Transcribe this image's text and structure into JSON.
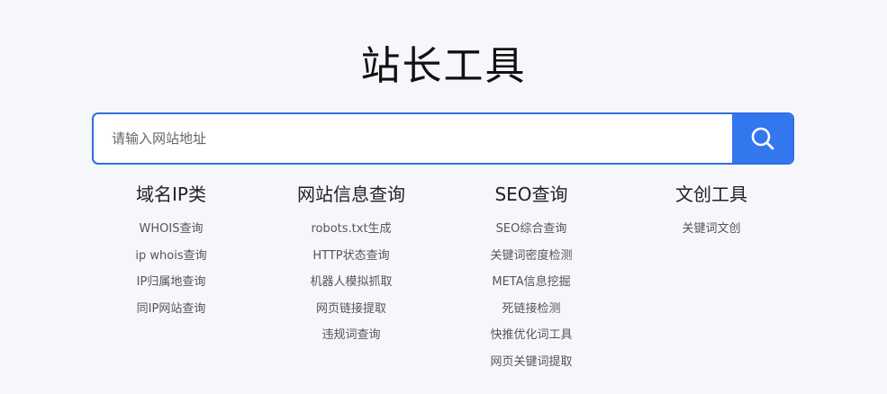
{
  "header": {
    "title": "站长工具"
  },
  "search": {
    "placeholder": "请输入网站地址",
    "button_icon": "search-icon",
    "accent_color": "#3377ee"
  },
  "categories": [
    {
      "title": "域名IP类",
      "items": [
        "WHOIS查询",
        "ip whois查询",
        "IP归属地查询",
        "同IP网站查询"
      ]
    },
    {
      "title": "网站信息查询",
      "items": [
        "robots.txt生成",
        "HTTP状态查询",
        "机器人模拟抓取",
        "网页链接提取",
        "违规词查询"
      ]
    },
    {
      "title": "SEO查询",
      "items": [
        "SEO综合查询",
        "关键词密度检测",
        "META信息挖掘",
        "死链接检测",
        "快推优化词工具",
        "网页关键词提取"
      ]
    },
    {
      "title": "文创工具",
      "items": [
        "关键词文创"
      ]
    }
  ]
}
